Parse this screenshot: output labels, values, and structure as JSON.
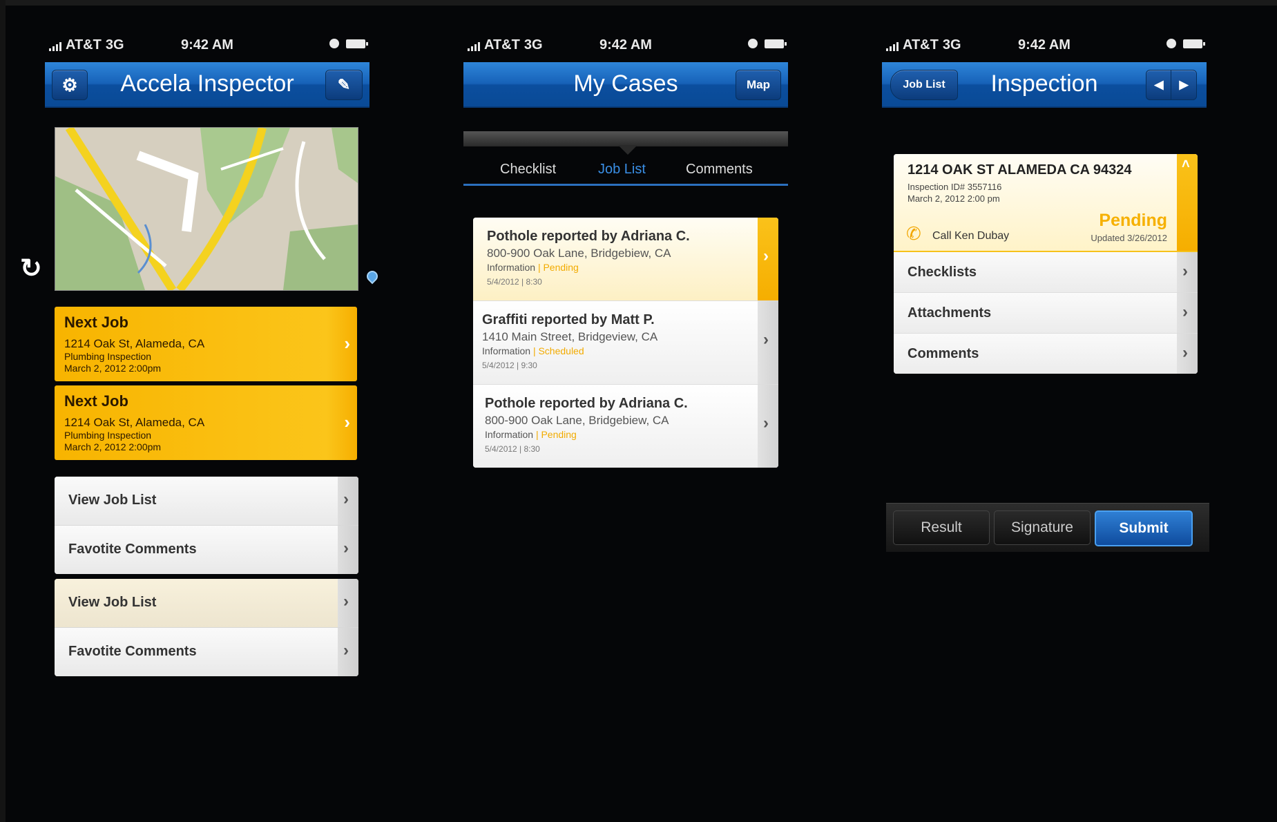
{
  "status": {
    "carrier": "AT&T",
    "network": "3G",
    "time": "9:42 AM"
  },
  "screen1": {
    "title": "Accela Inspector",
    "jobs": [
      {
        "heading": "Next Job",
        "address": "1214 Oak St, Alameda, CA",
        "type": "Plumbing Inspection",
        "datetime": "March 2, 2012  2:00pm"
      },
      {
        "heading": "Next Job",
        "address": "1214 Oak St, Alameda, CA",
        "type": "Plumbing Inspection",
        "datetime": "March 2, 2012  2:00pm"
      }
    ],
    "group1": [
      "View Job List",
      "Favotite Comments"
    ],
    "group2": [
      "View Job List",
      "Favotite Comments"
    ]
  },
  "screen2": {
    "title": "My Cases",
    "map_button": "Map",
    "tabs": [
      "Checklist",
      "Job List",
      "Comments"
    ],
    "cases": [
      {
        "title": "Pothole reported by Adriana C.",
        "address": "800-900 Oak Lane, Bridgebiew, CA",
        "info": "Information",
        "sep": "|",
        "status": "Pending",
        "date": "5/4/2012 | 8:30"
      },
      {
        "title": "Graffiti reported by Matt P.",
        "address": "1410 Main Street, Bridgeview, CA",
        "info": "Information",
        "sep": "|",
        "status": "Scheduled",
        "date": "5/4/2012 | 9:30"
      },
      {
        "title": "Pothole reported by Adriana C.",
        "address": "800-900 Oak Lane, Bridgebiew, CA",
        "info": "Information",
        "sep": "|",
        "status": "Pending",
        "date": "5/4/2012 | 8:30"
      }
    ]
  },
  "screen3": {
    "back_button": "Job List",
    "title": "Inspection",
    "address": "1214 OAK ST ALAMEDA CA 94324",
    "inspection_id": "Inspection ID# 3557116",
    "datetime": "March 2, 2012 2:00 pm",
    "call": "Call Ken Dubay",
    "status": "Pending",
    "updated": "Updated 3/26/2012",
    "rows": [
      "Checklists",
      "Attachments",
      "Comments"
    ],
    "actions": [
      "Result",
      "Signature",
      "Submit"
    ]
  },
  "colors": {
    "nav_blue": "#1762b8",
    "accent_yellow": "#f6b000",
    "tab_blue": "#3a8fe6"
  }
}
